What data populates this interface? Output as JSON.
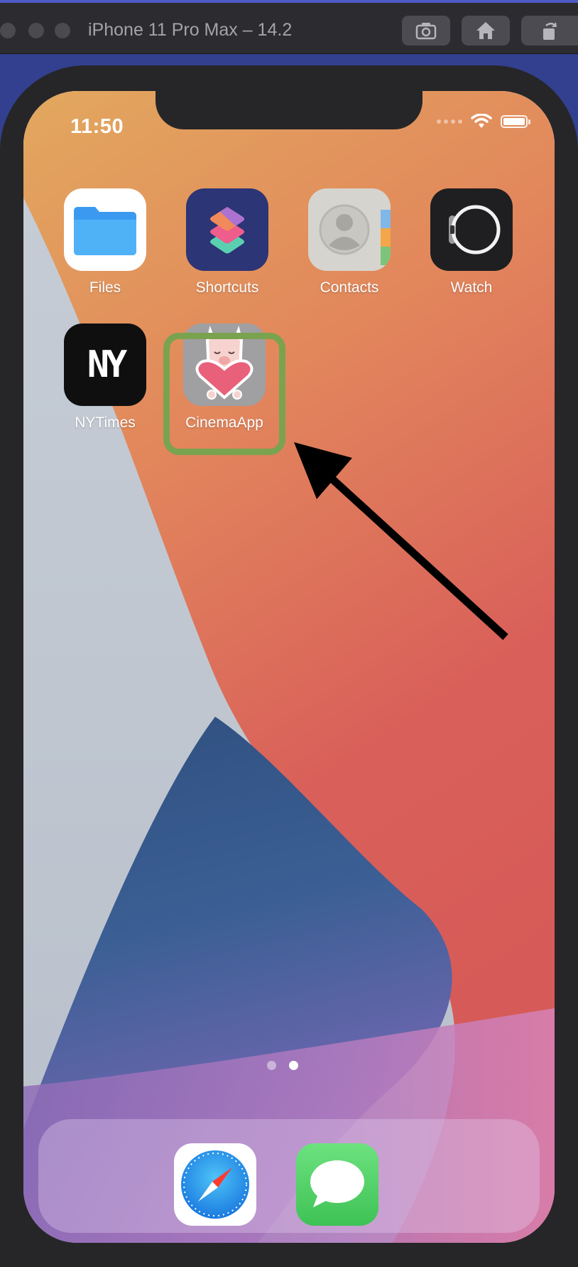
{
  "simulator": {
    "title": "iPhone 11 Pro Max – 14.2",
    "buttons": [
      {
        "icon": "screenshot-camera-icon"
      },
      {
        "icon": "home-icon"
      },
      {
        "icon": "rotate-icon"
      }
    ]
  },
  "status_bar": {
    "time": "11:50",
    "icons": [
      "signal-dots-icon",
      "wifi-icon",
      "battery-icon"
    ]
  },
  "apps": [
    {
      "label": "Files",
      "icon": "files-folder-icon"
    },
    {
      "label": "Shortcuts",
      "icon": "shortcuts-icon"
    },
    {
      "label": "Contacts",
      "icon": "contacts-icon"
    },
    {
      "label": "Watch",
      "icon": "watch-icon"
    },
    {
      "label": "NYTimes",
      "icon": "nytimes-icon",
      "icon_text": "NY"
    },
    {
      "label": "CinemaApp",
      "icon": "llama-heart-icon"
    }
  ],
  "page_indicator": {
    "pages": 2,
    "current": 2
  },
  "dock": [
    {
      "icon": "safari-icon"
    },
    {
      "icon": "messages-icon"
    }
  ],
  "colors": {
    "highlight": "#7aa34f",
    "arrow": "#000000",
    "wallpaper_orange": "#e49a5a",
    "wallpaper_red": "#d85a56",
    "wallpaper_blue": "#3a5e93"
  }
}
